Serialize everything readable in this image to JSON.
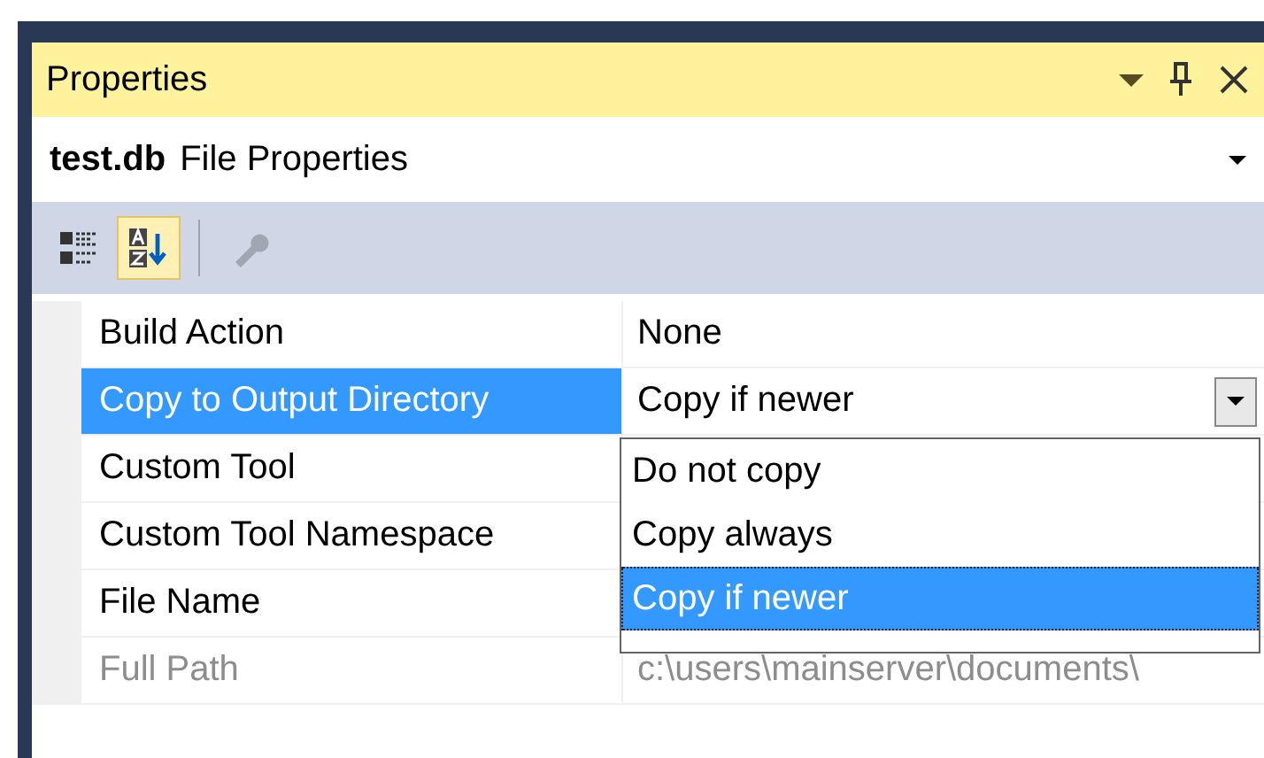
{
  "panel": {
    "title": "Properties"
  },
  "object_selector": {
    "name": "test.db",
    "type": "File Properties"
  },
  "toolbar": [
    {
      "kind": "categorized",
      "selected": false,
      "disabled": false
    },
    {
      "kind": "alphabetical",
      "selected": true,
      "disabled": false
    },
    {
      "kind": "property-pages",
      "selected": false,
      "disabled": true
    }
  ],
  "properties": [
    {
      "name": "Build Action",
      "value": "None",
      "selected": false,
      "disabled": false
    },
    {
      "name": "Copy to Output Directory",
      "value": "Copy if newer",
      "selected": true,
      "disabled": false,
      "options": [
        {
          "label": "Do not copy",
          "selected": false
        },
        {
          "label": "Copy always",
          "selected": false
        },
        {
          "label": "Copy if newer",
          "selected": true
        }
      ]
    },
    {
      "name": "Custom Tool",
      "selected": false,
      "disabled": false
    },
    {
      "name": "Custom Tool Namespace",
      "selected": false,
      "disabled": false
    },
    {
      "name": "File Name",
      "selected": false,
      "disabled": false
    },
    {
      "name": "Full Path",
      "value": "c:\\users\\mainserver\\documents\\",
      "selected": false,
      "disabled": true
    }
  ]
}
